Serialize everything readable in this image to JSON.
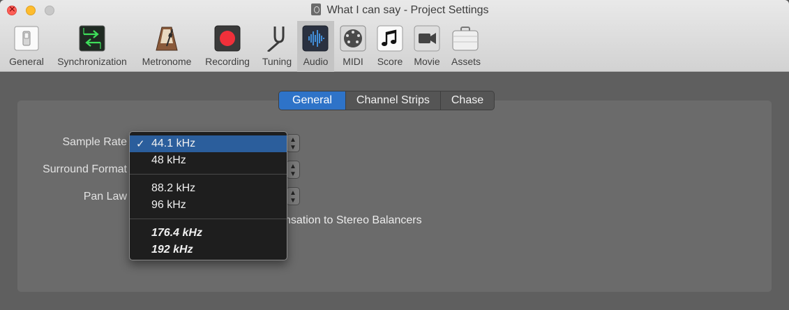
{
  "window": {
    "title": "What I can say - Project Settings"
  },
  "toolbar": {
    "items": [
      {
        "label": "General",
        "icon": "switch-icon"
      },
      {
        "label": "Synchronization",
        "icon": "sync-arrows-icon"
      },
      {
        "label": "Metronome",
        "icon": "metronome-icon"
      },
      {
        "label": "Recording",
        "icon": "record-icon"
      },
      {
        "label": "Tuning",
        "icon": "tuning-fork-icon"
      },
      {
        "label": "Audio",
        "icon": "audio-waveform-icon"
      },
      {
        "label": "MIDI",
        "icon": "midi-connector-icon"
      },
      {
        "label": "Score",
        "icon": "music-note-icon"
      },
      {
        "label": "Movie",
        "icon": "video-camera-icon"
      },
      {
        "label": "Assets",
        "icon": "briefcase-icon"
      }
    ],
    "selected": "Audio"
  },
  "tabs": {
    "items": [
      "General",
      "Channel Strips",
      "Chase"
    ],
    "active": "General"
  },
  "form": {
    "sample_rate_label": "Sample Rate",
    "surround_format_label": "Surround Format",
    "pan_law_label": "Pan Law",
    "compensation_text": "nsation to Stereo Balancers"
  },
  "sample_rate_menu": {
    "check": "✓",
    "groups": [
      [
        "44.1 kHz",
        "48 kHz"
      ],
      [
        "88.2 kHz",
        "96 kHz"
      ],
      [
        "176.4 kHz",
        "192 kHz"
      ]
    ],
    "selected": "44.1 kHz"
  },
  "colors": {
    "accent": "#2e73c8",
    "menu_selection": "#2b5e9c",
    "record_red": "#f0303a"
  }
}
